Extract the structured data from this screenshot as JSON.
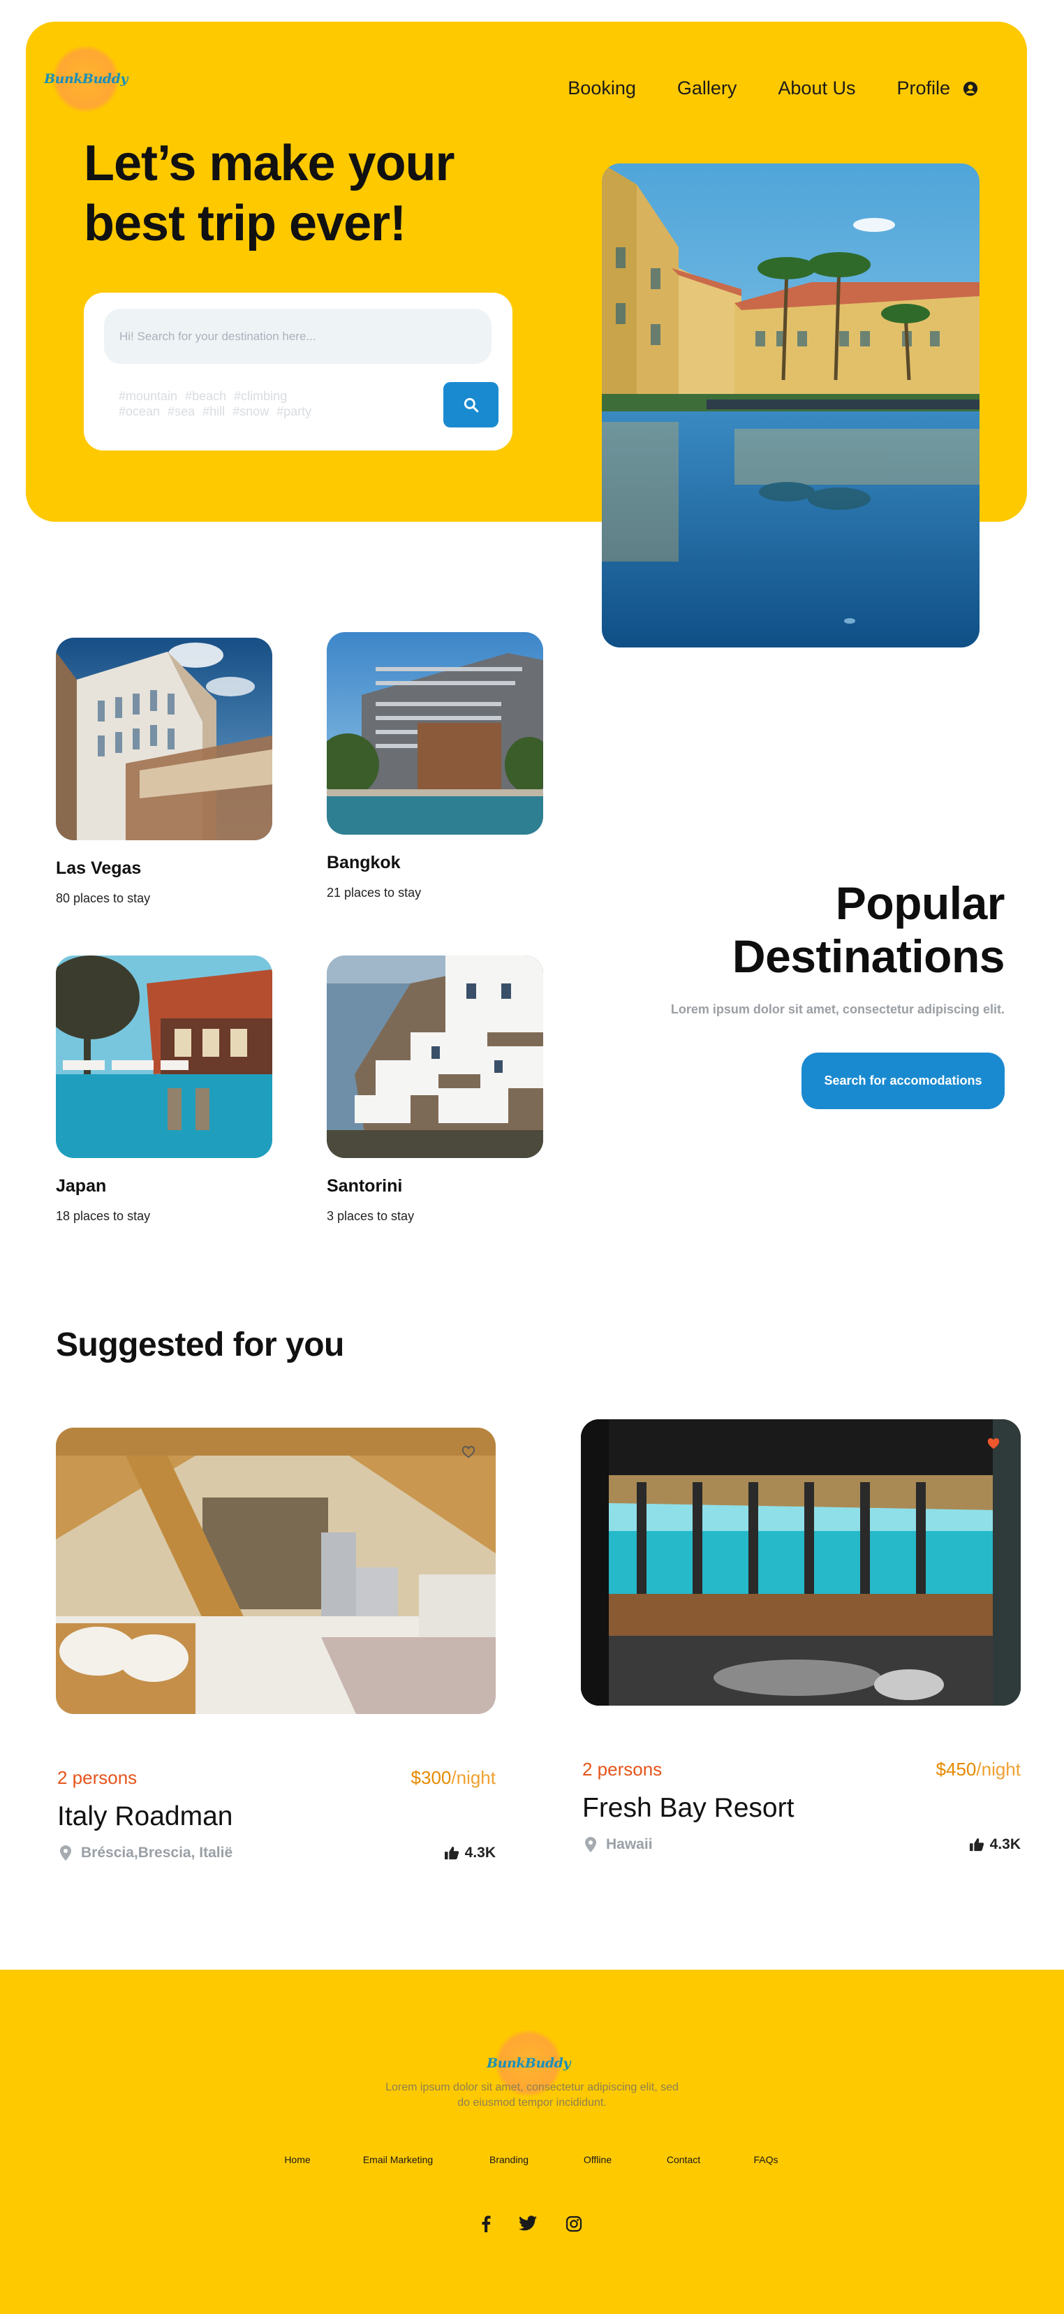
{
  "brand": {
    "logo_text": "BunkBuddy"
  },
  "nav": {
    "items": [
      "Booking",
      "Gallery",
      "About Us"
    ],
    "profile_label": "Profile"
  },
  "hero": {
    "title": "Let’s make your best trip ever!",
    "search_placeholder": "Hi! Search for your destination here...",
    "tags_line1": "#mountain  #beach  #climbing",
    "tags_line2": "#ocean  #sea  #hill  #snow  #party"
  },
  "destinations": [
    {
      "name": "Las Vegas",
      "count": "80 places to stay"
    },
    {
      "name": "Bangkok",
      "count": "21 places to stay"
    },
    {
      "name": "Japan",
      "count": "18 places to stay"
    },
    {
      "name": "Santorini",
      "count": "3 places to stay"
    }
  ],
  "popular": {
    "title_line1": "Popular",
    "title_line2": "Destinations",
    "subtitle": "Lorem ipsum dolor sit amet, consectetur adipiscing elit.",
    "button": "Search for accomodations"
  },
  "suggested": {
    "title": "Suggested for you",
    "cards": [
      {
        "persons": "2 persons",
        "price": "$300",
        "price_unit": "/night",
        "name": "Italy Roadman",
        "location": "Bréscia,Brescia, Italië",
        "likes": "4.3K",
        "favorited": false
      },
      {
        "persons": "2 persons",
        "price": "$450",
        "price_unit": "/night",
        "name": "Fresh Bay Resort",
        "location": "Hawaii",
        "likes": "4.3K",
        "favorited": true
      }
    ]
  },
  "footer": {
    "text": "Lorem ipsum dolor sit amet, consectetur adipiscing elit, sed do eiusmod tempor incididunt.",
    "links": [
      "Home",
      "Email Marketing",
      "Branding",
      "Offline",
      "Contact",
      "FAQs"
    ],
    "socials": [
      "facebook-icon",
      "twitter-icon",
      "instagram-icon"
    ]
  },
  "colors": {
    "yellow": "#ffc900",
    "blue": "#1a8ad0",
    "orange": "#e5541b",
    "price": "#e58a00"
  }
}
